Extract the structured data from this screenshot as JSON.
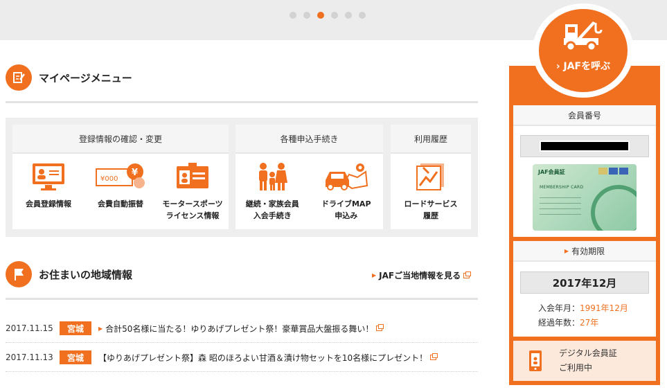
{
  "carousel": {
    "dot_count": 6,
    "active_index": 2
  },
  "mypage": {
    "title": "マイページメニュー",
    "groups": [
      {
        "title": "登録情報の確認・変更",
        "items": [
          {
            "label": "会員登録情報",
            "icon": "monitor-profile-icon"
          },
          {
            "label": "会費自動振替",
            "icon": "yen-payment-icon"
          },
          {
            "label": "モータースポーツ\nライセンス情報",
            "icon": "license-card-icon"
          }
        ]
      },
      {
        "title": "各種申込手続き",
        "items": [
          {
            "label": "継続・家族会員\n入会手続き",
            "icon": "family-icon"
          },
          {
            "label": "ドライブMAP\n申込み",
            "icon": "car-map-icon"
          }
        ]
      },
      {
        "title": "利用履歴",
        "items": [
          {
            "label": "ロードサービス\n履歴",
            "icon": "road-service-history-icon"
          }
        ]
      }
    ]
  },
  "local": {
    "title": "お住まいの地域情報",
    "link_label": "JAFご当地情報を見る",
    "news": [
      {
        "date": "2017.11.15",
        "region": "宮城",
        "text": "合計50名様に当たる！ゆりあげプレゼント祭！豪華賞品大盤振る舞い！"
      },
      {
        "date": "2017.11.13",
        "region": "宮城",
        "text": "【ゆりあげプレゼント祭】森 昭のほろよい甘酒＆漬け物セットを10名様にプレゼント！"
      }
    ]
  },
  "sidebar": {
    "call_label": "› JAFを呼ぶ",
    "member_number_title": "会員番号",
    "card": {
      "logo": "JAF会員証",
      "title": "MEMBERSHIP CARD"
    },
    "expiry_title": "有効期限",
    "expiry_value": "2017年12月",
    "joined_label": "入会年月：",
    "joined_value": "1991年12月",
    "years_label": "経過年数：",
    "years_value": "27年",
    "digital_label": "デジタル会員証\nご利用中"
  },
  "colors": {
    "accent": "#f07020",
    "panel": "#eeeeee"
  }
}
